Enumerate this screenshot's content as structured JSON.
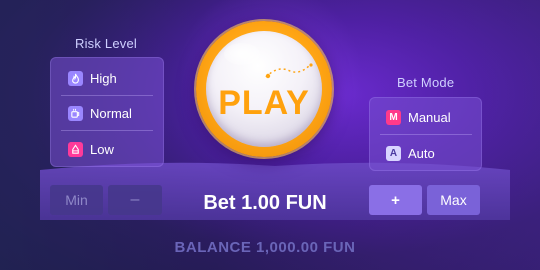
{
  "risk": {
    "title": "Risk Level",
    "options": [
      {
        "label": "High",
        "icon": "flame-icon",
        "glyph": "🔥"
      },
      {
        "label": "Normal",
        "icon": "mug-icon",
        "glyph": "☕"
      },
      {
        "label": "Low",
        "icon": "drop-icon",
        "glyph": "♁"
      }
    ]
  },
  "mode": {
    "title": "Bet Mode",
    "options": [
      {
        "label": "Manual",
        "icon": "manual-m-icon",
        "glyph": "M"
      },
      {
        "label": "Auto",
        "icon": "auto-a-icon",
        "glyph": "A"
      }
    ]
  },
  "play": {
    "label": "PLAY"
  },
  "controls": {
    "min_label": "Min",
    "minus_label": "–",
    "plus_label": "+",
    "max_label": "Max"
  },
  "bet": {
    "text": "Bet 1.00 FUN"
  },
  "balance": {
    "text": "BALANCE 1,000.00 FUN"
  },
  "colors": {
    "accent_orange": "#ffa514",
    "panel_purple": "#7850d2",
    "pink_icon": "#ff3a9a"
  }
}
